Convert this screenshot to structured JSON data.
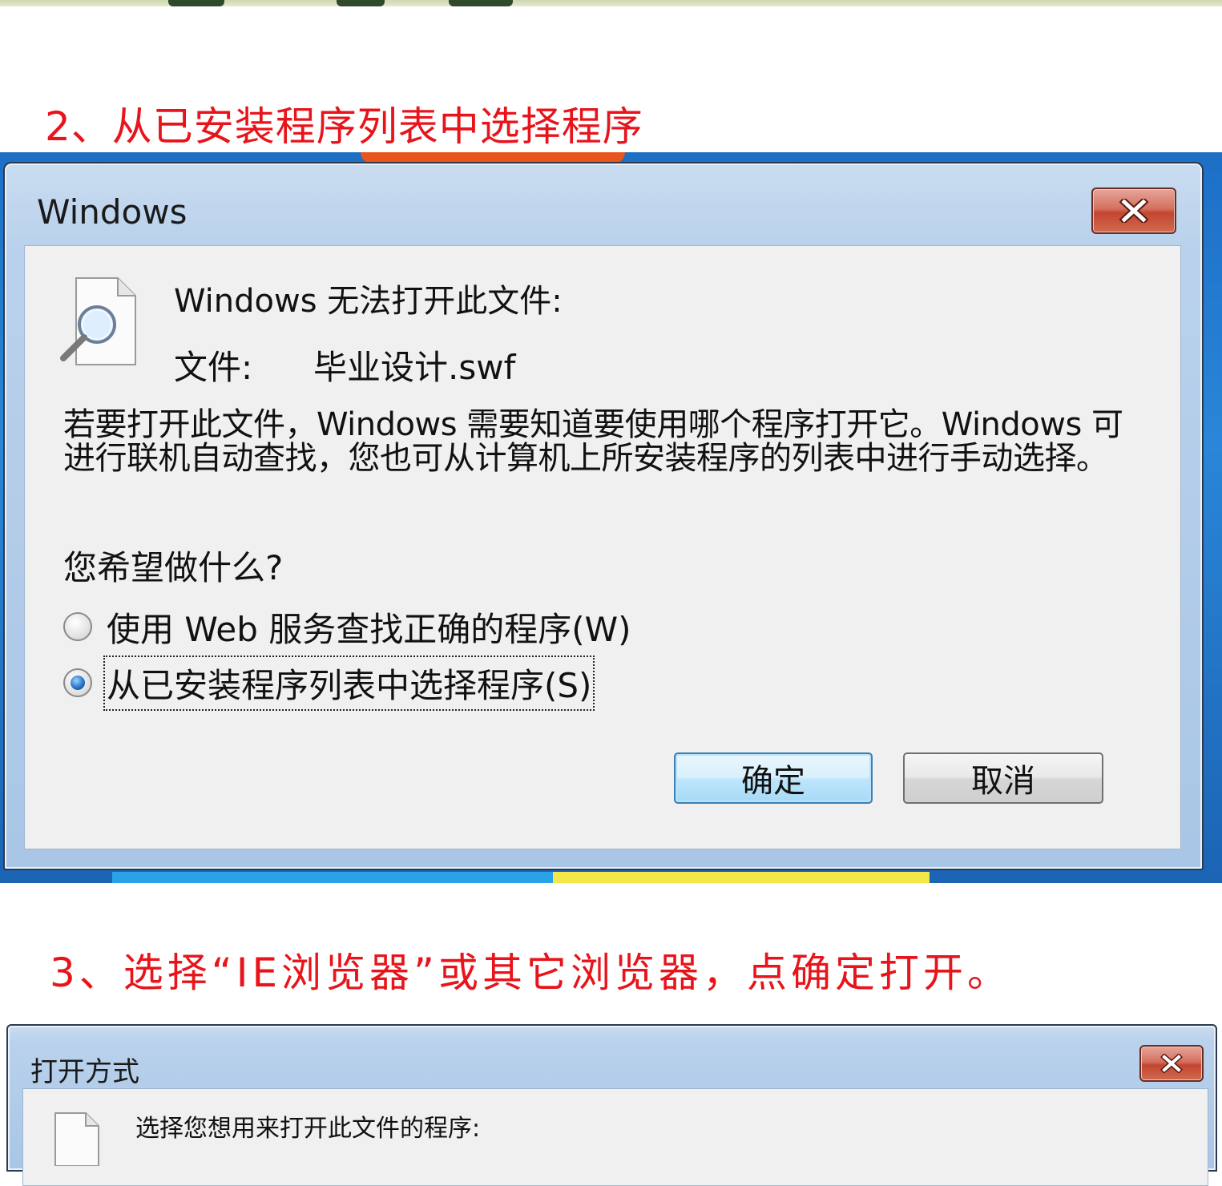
{
  "step2": {
    "heading": "2、从已安装程序列表中选择程序"
  },
  "step3": {
    "heading": "3、选择“IE浏览器”或其它浏览器，点确定打开。"
  },
  "dialog1": {
    "title": "Windows",
    "cannot_open": "Windows 无法打开此文件:",
    "file_label": "文件:",
    "file_name": "毕业设计.swf",
    "explanation": "若要打开此文件，Windows 需要知道要使用哪个程序打开它。Windows 可进行联机自动查找，您也可从计算机上所安装程序的列表中进行手动选择。",
    "question": "您希望做什么?",
    "options": [
      {
        "label": "使用 Web 服务查找正确的程序(W)",
        "checked": false
      },
      {
        "label": "从已安装程序列表中选择程序(S)",
        "checked": true
      }
    ],
    "ok_label": "确定",
    "cancel_label": "取消"
  },
  "dialog2": {
    "title": "打开方式",
    "prompt": "选择您想用来打开此文件的程序:"
  },
  "icons": {
    "close": "close-icon",
    "file_search": "file-search-icon"
  },
  "colors": {
    "heading_red": "#e8141b",
    "dialog_face": "#f0f0f0",
    "close_red": "#c24631",
    "default_button_blue": "#3c7fb1"
  }
}
